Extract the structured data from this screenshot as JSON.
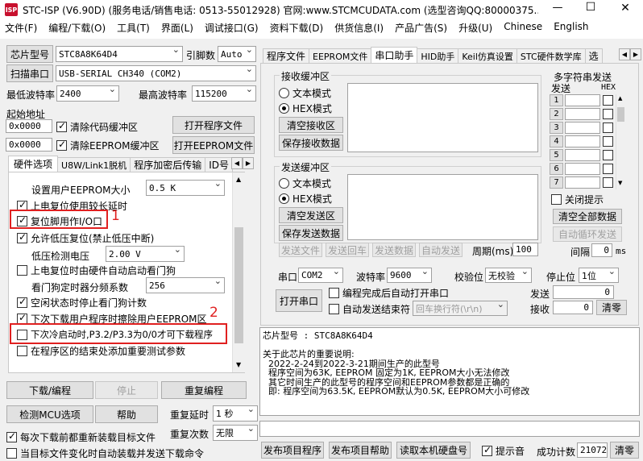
{
  "window": {
    "title": "STC-ISP (V6.90D) (服务电话/销售电话: 0513-55012928) 官网:www.STCMCUDATA.com  (选型咨询QQ:80000375...",
    "minimize": "—",
    "maximize": "☐",
    "close": "✕"
  },
  "menu": [
    "文件(F)",
    "编程/下载(O)",
    "工具(T)",
    "界面(L)",
    "调试接口(G)",
    "资料下载(D)",
    "供货信息(I)",
    "产品广告(S)",
    "升级(U)",
    "Chinese",
    "English"
  ],
  "left": {
    "chip_btn": "芯片型号",
    "chip_value": "STC8A8K64D4",
    "pins_label": "引脚数",
    "pins_value": "Auto",
    "scan_btn": "扫描串口",
    "port_value": "USB-SERIAL CH340 (COM2)",
    "min_baud_label": "最低波特率",
    "min_baud": "2400",
    "max_baud_label": "最高波特率",
    "max_baud": "115200",
    "start_addr_label": "起始地址",
    "addr1": "0x0000",
    "clear_code": "清除代码缓冲区",
    "open_prog": "打开程序文件",
    "addr2": "0x0000",
    "clear_eeprom": "清除EEPROM缓冲区",
    "open_eeprom": "打开EEPROM文件",
    "tabs": [
      "硬件选项",
      "U8W/Link1脱机",
      "程序加密后传输",
      "ID号"
    ],
    "options": {
      "eeprom_size_label": "设置用户EEPROM大小",
      "eeprom_size": "0.5 K",
      "por_delay": "上电复位使用较长延时",
      "reset_io": "复位脚用作I/O口",
      "low_volt_reset": "允许低压复位(禁止低压中断)",
      "low_volt_label": "低压检测电压",
      "low_volt": "2.00 V",
      "wdt_start": "上电复位时由硬件自动启动看门狗",
      "wdt_div_label": "看门狗定时器分频系数",
      "wdt_div": "256",
      "idle_wdt": "空闲状态时停止看门狗计数",
      "erase_eeprom": "下次下载用户程序时擦除用户EEPROM区",
      "p32_p33": "下次冷启动时,P3.2/P3.3为0/0才可下载程序",
      "test_params": "在程序区的结束处添加重要测试参数"
    },
    "annot1": "1",
    "annot2": "2",
    "download_btn": "下载/编程",
    "stop_btn": "停止",
    "reprog_btn": "重复编程",
    "detect_btn": "检测MCU选项",
    "help_btn": "帮助",
    "repeat_delay_label": "重复延时",
    "repeat_delay": "1 秒",
    "repeat_count_label": "重复次数",
    "repeat_count": "无限",
    "reload_before": "每次下载前都重新装载目标文件",
    "auto_load": "当目标文件变化时自动装载并发送下载命令"
  },
  "right": {
    "tabs": [
      "程序文件",
      "EEPROM文件",
      "串口助手",
      "HID助手",
      "Keil仿真设置",
      "STC硬件数学库",
      "选"
    ],
    "recv_group": "接收缓冲区",
    "recv_text": "文本模式",
    "recv_hex": "HEX模式",
    "clear_recv": "清空接收区",
    "save_recv": "保存接收数据",
    "send_group": "发送缓冲区",
    "send_text": "文本模式",
    "send_hex": "HEX模式",
    "clear_send": "清空发送区",
    "save_send": "保存发送数据",
    "send_file": "发送文件",
    "send_return": "发送回车",
    "send_data": "发送数据",
    "auto_send": "自动发送",
    "period_label": "周期(ms)",
    "period": "100",
    "port_label": "串口",
    "port": "COM2",
    "baud_label": "波特率",
    "baud": "9600",
    "parity_label": "校验位",
    "parity": "无校验",
    "stop_label": "停止位",
    "stop": "1位",
    "open_port": "打开串口",
    "auto_open": "编程完成后自动打开串口",
    "auto_end": "自动发送结束符",
    "end_char": "回车换行符(\\r\\n)",
    "sent_label": "发送",
    "sent": "0",
    "recv_label": "接收",
    "recv": "0",
    "clear_cnt": "清零",
    "multi_title": "多字符串发送",
    "multi_send": "发送",
    "multi_hex": "HEX",
    "rows": [
      "1",
      "2",
      "3",
      "4",
      "5",
      "6",
      "7"
    ],
    "close_tip": "关闭提示",
    "clear_all": "清空全部数据",
    "auto_loop": "自动循环发送",
    "interval_label": "间隔",
    "interval": "0",
    "interval_unit": "ms"
  },
  "info": {
    "lines": [
      "芯片型号 : STC8A8K64D4",
      "",
      "关于此芯片的重要说明:",
      "  2022-2-24到2022-3-21期间生产的此型号",
      "  程序空间为63K, EEPROM 固定为1K, EEPROM大小无法修改",
      "  其它时间生产的此型号的程序空间和EEPROM参数都是正确的",
      "  即: 程序空间为63.5K, EEPROM默认为0.5K, EEPROM大小可修改"
    ]
  },
  "bottom": {
    "publish": "发布项目程序",
    "publish_help": "发布项目帮助",
    "read_disk": "读取本机硬盘号",
    "beep": "提示音",
    "success_label": "成功计数",
    "success": "21072",
    "clear": "清零"
  }
}
